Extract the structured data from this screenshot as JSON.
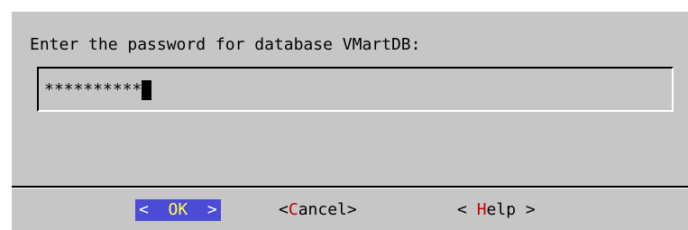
{
  "dialog": {
    "prompt": "Enter the password for database VMartDB:",
    "password_masked": "**********"
  },
  "buttons": {
    "ok": {
      "left": "<",
      "hot": "OK",
      "right": ">"
    },
    "cancel": {
      "left": "<",
      "hot": "C",
      "rest": "ancel",
      "right": ">"
    },
    "help": {
      "left": "< ",
      "hot": "H",
      "rest": "elp",
      "right": " >"
    }
  },
  "colors": {
    "dialog_background": "#c6c6c6",
    "focused_button_background": "#4b4bd6",
    "focused_hotkey": "#ffff55",
    "hotkey": "#c40000"
  }
}
